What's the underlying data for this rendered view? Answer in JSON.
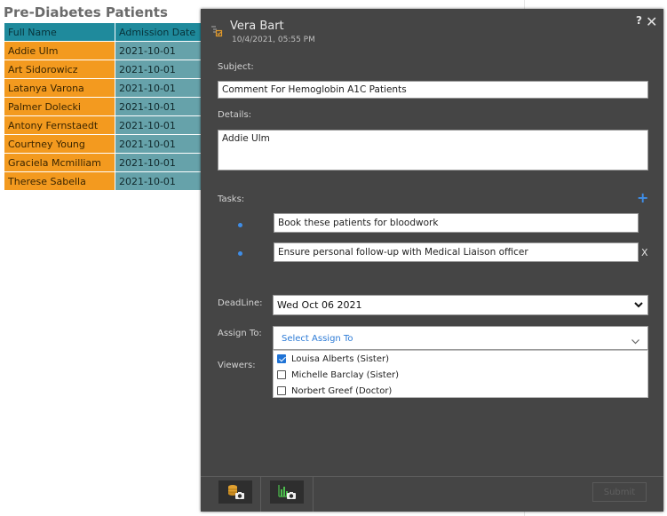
{
  "background": {
    "title": "Pre-Diabetes Patients",
    "columns": [
      "Full Name",
      "Admission Date"
    ],
    "rows": [
      {
        "name": "Addie Ulm",
        "date": "2021-10-01"
      },
      {
        "name": "Art Sidorowicz",
        "date": "2021-10-01"
      },
      {
        "name": "Latanya Varona",
        "date": "2021-10-01"
      },
      {
        "name": "Palmer Dolecki",
        "date": "2021-10-01"
      },
      {
        "name": "Antony Fernstaedt",
        "date": "2021-10-01"
      },
      {
        "name": "Courtney Young",
        "date": "2021-10-01"
      },
      {
        "name": "Graciela Mcmilliam",
        "date": "2021-10-01"
      },
      {
        "name": "Therese Sabella",
        "date": "2021-10-01"
      }
    ],
    "colors": {
      "header": "#1f8a9c",
      "name_cell": "#f39a1f",
      "date_cell": "#66a2aa"
    }
  },
  "dialog": {
    "author": "Vera Bart",
    "timestamp": "10/4/2021, 05:55 PM",
    "help_label": "?",
    "close_label": "✕",
    "subject_label": "Subject:",
    "subject_value": "Comment For Hemoglobin A1C Patients",
    "details_label": "Details:",
    "details_value": "Addie Ulm",
    "tasks_label": "Tasks:",
    "add_task_label": "+",
    "tasks": [
      {
        "text": "Book these patients for bloodwork"
      },
      {
        "text": "Ensure personal follow-up with Medical Liaison officer"
      }
    ],
    "remove_task_label": "X",
    "deadline_label": "DeadLine:",
    "deadline_value": "Wed Oct 06 2021",
    "assign_label": "Assign To:",
    "assign_placeholder": "Select Assign To",
    "viewers_label": "Viewers:",
    "assign_options": [
      {
        "label": "Louisa Alberts (Sister)",
        "checked": true
      },
      {
        "label": "Michelle Barclay (Sister)",
        "checked": false
      },
      {
        "label": "Norbert Greef (Doctor)",
        "checked": false
      }
    ],
    "submit_label": "Submit",
    "icons": {
      "header": "task-list-icon",
      "snapshot_1": "data-snapshot-icon",
      "snapshot_2": "chart-snapshot-icon"
    },
    "accent_color": "#3f8ee8",
    "background_color": "#454545"
  }
}
